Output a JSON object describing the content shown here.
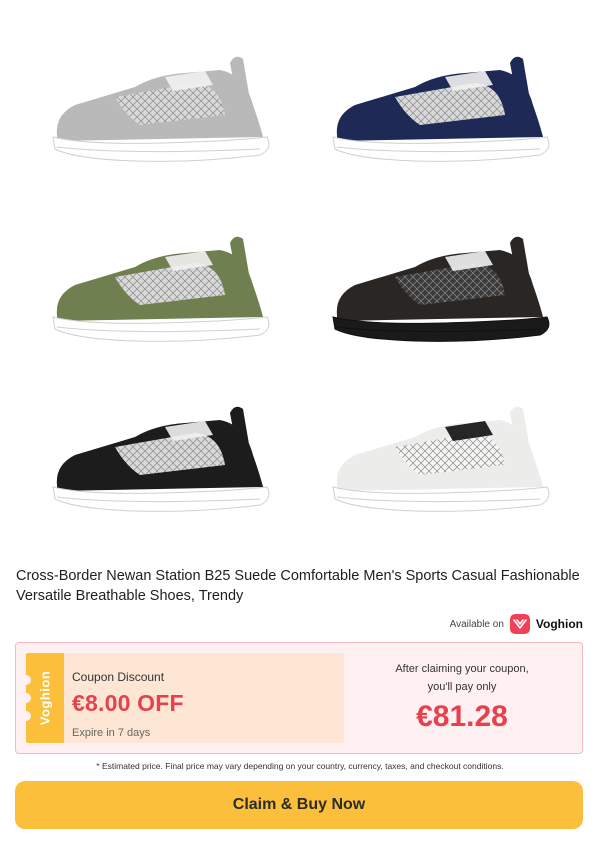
{
  "product": {
    "title": "Cross-Border Newan Station B25 Suede Comfortable Men's Sports Casual Fashionable Versatile Breathable Shoes, Trendy",
    "variants": [
      {
        "name": "grey",
        "base": "#b9b9b9",
        "accent": "#d8d8d8"
      },
      {
        "name": "navy",
        "base": "#1e2a55",
        "accent": "#d8d8d8"
      },
      {
        "name": "olive",
        "base": "#6f7f50",
        "accent": "#d8d8d8"
      },
      {
        "name": "black",
        "base": "#2a2624",
        "accent": "#3a3a3a"
      },
      {
        "name": "black-white",
        "base": "#1c1c1c",
        "accent": "#d8d8d8"
      },
      {
        "name": "white",
        "base": "#ececea",
        "accent": "#f5f5f3"
      }
    ]
  },
  "availability": {
    "label": "Available on",
    "brand": "Voghion",
    "brand_color": "#f0405a"
  },
  "coupon": {
    "stub_text": "Voghion",
    "label": "Coupon Discount",
    "amount": "€8.00 OFF",
    "expire": "Expire in 7 days",
    "pay_line1": "After claiming your coupon,",
    "pay_line2": "you'll pay only",
    "final_price": "€81.28"
  },
  "disclaimer": "* Estimated price. Final price may vary depending on your country, currency, taxes, and checkout conditions.",
  "cta": {
    "label": "Claim & Buy Now"
  },
  "colors": {
    "accent_red": "#e8414e",
    "cta_yellow": "#fbbf3b",
    "coupon_bg": "#fff0f2"
  }
}
